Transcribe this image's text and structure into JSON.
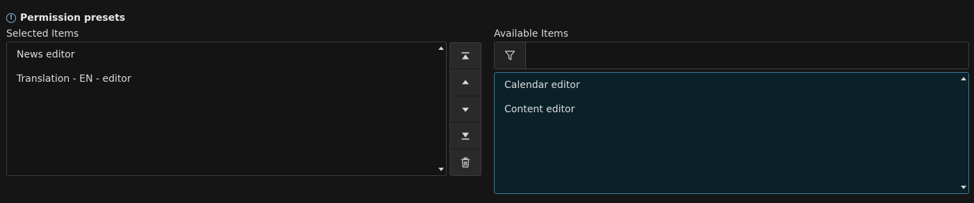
{
  "section": {
    "title": "Permission presets",
    "info_icon": "info-circle-icon"
  },
  "selected": {
    "label": "Selected Items",
    "items": [
      "News editor",
      "Translation - EN - editor"
    ]
  },
  "buttons": [
    {
      "name": "move-to-top",
      "icon": "arrow-to-top-icon"
    },
    {
      "name": "move-up",
      "icon": "triangle-up-icon"
    },
    {
      "name": "move-down",
      "icon": "triangle-down-icon"
    },
    {
      "name": "move-to-bottom",
      "icon": "arrow-to-bottom-icon"
    },
    {
      "name": "remove",
      "icon": "trash-icon"
    }
  ],
  "available": {
    "label": "Available Items",
    "filter_value": "",
    "filter_placeholder": "",
    "filter_icon": "filter-icon",
    "items": [
      "Calendar editor",
      "Content editor"
    ]
  },
  "colors": {
    "background": "#151515",
    "accent_border": "#3b7b98",
    "available_bg": "#0b2129",
    "info_icon": "#7fb8d8"
  }
}
